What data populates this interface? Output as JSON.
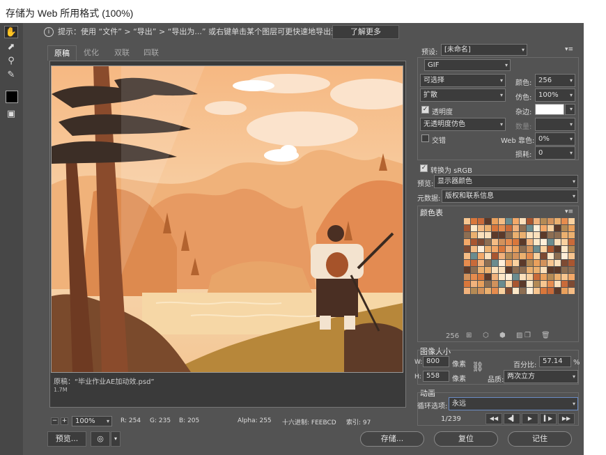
{
  "window": {
    "title": "存储为 Web 所用格式 (100%)"
  },
  "hint": {
    "text": "提示：使用 “文件” > “导出” > “导出为...” 或右键单击某个图层可更快速地导出资源",
    "learn_more": "了解更多"
  },
  "tabs": [
    "原稿",
    "优化",
    "双联",
    "四联"
  ],
  "preview": {
    "caption": "原稿：“毕业作业AE加动效.psd”",
    "size": "1.7M"
  },
  "statusbar": {
    "zoom": "100%",
    "r": "R:  254",
    "g": "G:  235",
    "b": "B:  205",
    "alpha": "Alpha:  255",
    "hex": "十六进制:  FEEBCD",
    "index": "索引:  97"
  },
  "settings": {
    "preset_label": "预设:",
    "preset_value": "[未命名]",
    "format": "GIF",
    "reduction": "可选择",
    "colors_label": "颜色:",
    "colors_value": "256",
    "dither_algo": "扩散",
    "dither_label": "仿色:",
    "dither_value": "100%",
    "transparency_label": "透明度",
    "transparency_checked": true,
    "matte_label": "杂边:",
    "matte_color": "#ffffff",
    "trans_dither": "无透明度仿色",
    "amount_label": "数量:",
    "interlaced_label": "交错",
    "interlaced_checked": false,
    "websnap_label": "Web 靠色:",
    "websnap_value": "0%",
    "lossy_label": "损耗:",
    "lossy_value": "0",
    "srgb_label": "转换为 sRGB",
    "srgb_checked": true,
    "preview_label": "预览:",
    "preview_value": "显示器颜色",
    "metadata_label": "元数据:",
    "metadata_value": "版权和联系信息"
  },
  "color_table": {
    "title": "颜色表",
    "count": "256"
  },
  "image_size": {
    "title": "图像大小",
    "w_label": "W:",
    "w_value": "800",
    "h_label": "H:",
    "h_value": "558",
    "unit": "像素",
    "percent_label": "百分比:",
    "percent_value": "57.14",
    "percent_unit": "%",
    "quality_label": "品质:",
    "quality_value": "两次立方"
  },
  "animation": {
    "title": "动画",
    "loop_label": "循环选项:",
    "loop_value": "永远",
    "frame": "1/239"
  },
  "buttons": {
    "preview": "预览...",
    "save": "存储...",
    "reset": "复位",
    "remember": "记住"
  },
  "colors": {
    "accent_border": "#6b8cc5",
    "dialog_bg": "#535353"
  }
}
